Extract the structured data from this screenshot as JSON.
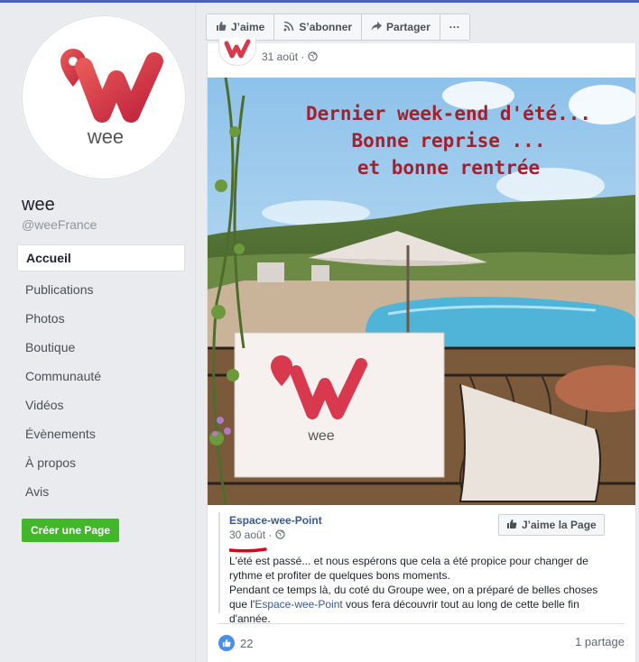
{
  "page": {
    "name": "wee",
    "handle": "@weeFrance",
    "logo_text": "wee",
    "brand_colors": [
      "#e04353",
      "#b8203a"
    ]
  },
  "nav": {
    "items": [
      {
        "label": "Accueil",
        "active": true
      },
      {
        "label": "Publications"
      },
      {
        "label": "Photos"
      },
      {
        "label": "Boutique"
      },
      {
        "label": "Communauté"
      },
      {
        "label": "Vidéos"
      },
      {
        "label": "Évènements"
      },
      {
        "label": "À propos"
      },
      {
        "label": "Avis"
      }
    ],
    "create_page": "Créer une Page"
  },
  "actions": {
    "like": "J’aime",
    "follow": "S’abonner",
    "share": "Partager",
    "more": "···"
  },
  "post": {
    "date": "31 août · ",
    "image_text": {
      "line1": "Dernier week-end d'été...",
      "line2": "Bonne reprise ...",
      "line3": "et bonne rentrée"
    },
    "shared": {
      "name": "Espace-wee-Point",
      "date": "30 août",
      "date_suffix": " · ",
      "like_page": "J’aime la Page",
      "text1": "L'été est passé... et nous espérons que cela a été propice pour changer de rythme et profiter de quelques bons moments.",
      "text2a": "Pendant ce temps là, du coté du Groupe wee, on a préparé de belles choses que l'",
      "text2_link": "Espace-wee-Point",
      "text2b": " vous fera découvrir tout au long de cette belle fin d'année."
    },
    "likes": "22",
    "shares": "1 partage"
  }
}
